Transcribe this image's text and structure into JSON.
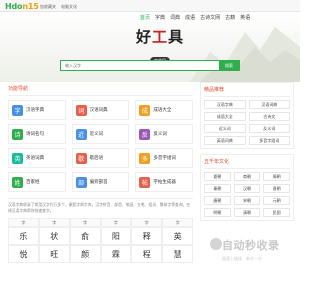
{
  "topbar": {
    "logo_main": "Hdo",
    "logo_num": "n15",
    "links": [
      "加收藏夹",
      "电脑文化"
    ]
  },
  "hero": {
    "brand_left": "好",
    "brand_mid": "工",
    "brand_right": "具",
    "brand_sub": "字典网",
    "nav": [
      "首页",
      "字典",
      "词典",
      "成语",
      "古诗文网",
      "古籍",
      "英语"
    ],
    "active_nav": 0,
    "search_placeholder": "输入汉字",
    "search_button": "搜索"
  },
  "tools_section": {
    "title": "功能导航",
    "tools": [
      {
        "label": "汉语字典",
        "icon": "字",
        "color": "#4a90e2"
      },
      {
        "label": "汉语词典",
        "icon": "词",
        "color": "#e8604c"
      },
      {
        "label": "成语大全",
        "icon": "成",
        "color": "#f0a020"
      },
      {
        "label": "诗词名句",
        "icon": "诗",
        "color": "#2fae4e"
      },
      {
        "label": "近义词",
        "icon": "近",
        "color": "#4a90e2"
      },
      {
        "label": "反义词",
        "icon": "反",
        "color": "#9b59b6"
      },
      {
        "label": "英语词典",
        "icon": "英",
        "color": "#1abc9c"
      },
      {
        "label": "歇后语",
        "icon": "歇",
        "color": "#e8604c"
      },
      {
        "label": "多音字组词",
        "icon": "多",
        "color": "#f0a020"
      },
      {
        "label": "百家姓",
        "icon": "姓",
        "color": "#2fae4e"
      },
      {
        "label": "偏旁部首",
        "icon": "部",
        "color": "#4a90e2"
      },
      {
        "label": "字帖生成器",
        "icon": "帖",
        "color": "#e8604c"
      }
    ]
  },
  "intro": "汉语字典收录了常用汉字约万多个，康熙字典字库，汉字拼音、部首、笔画、五笔、组词、繁体字等查询，在线汉语字典帮你快速查字。",
  "char_table": {
    "header": "字",
    "chars": [
      "乐",
      "状",
      "俞",
      "阳",
      "释",
      "英",
      "悦",
      "旺",
      "颜",
      "霖",
      "程",
      "慧"
    ]
  },
  "right_panels": [
    {
      "title": "精品推荐",
      "items": [
        "汉语字典",
        "汉语词典",
        "成语大全",
        "古诗文",
        "近义词",
        "反义词",
        "英语词典",
        "多音字组词"
      ]
    },
    {
      "title": "五千年文化",
      "items": [
        "夏朝",
        "商朝",
        "周朝",
        "秦朝",
        "汉朝",
        "晋朝",
        "唐朝",
        "宋朝",
        "元朝",
        "明朝",
        "清朝",
        "民国"
      ]
    }
  ],
  "watermark": {
    "title": "自动秒收录",
    "sub": "极速上链接 · 来访一次"
  }
}
